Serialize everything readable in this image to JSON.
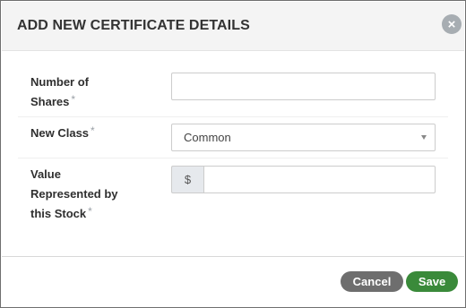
{
  "modal": {
    "title": "ADD NEW CERTIFICATE DETAILS",
    "close_glyph": "×"
  },
  "fields": {
    "shares": {
      "label_line1": "Number of",
      "label_line2": "Shares",
      "required": "*",
      "value": ""
    },
    "class": {
      "label": "New Class",
      "required": "*",
      "selected": "Common"
    },
    "value": {
      "label_line1": "Value",
      "label_line2": "Represented by",
      "label_line3": "this Stock",
      "required": "*",
      "prefix": "$",
      "value": ""
    }
  },
  "footer": {
    "cancel_label": "Cancel",
    "save_label": "Save"
  },
  "colors": {
    "save": "#3a8a3a",
    "cancel": "#6e6e6e",
    "header_bg": "#f4f4f4"
  },
  "icons": [
    "close-icon",
    "chevron-down-icon"
  ]
}
